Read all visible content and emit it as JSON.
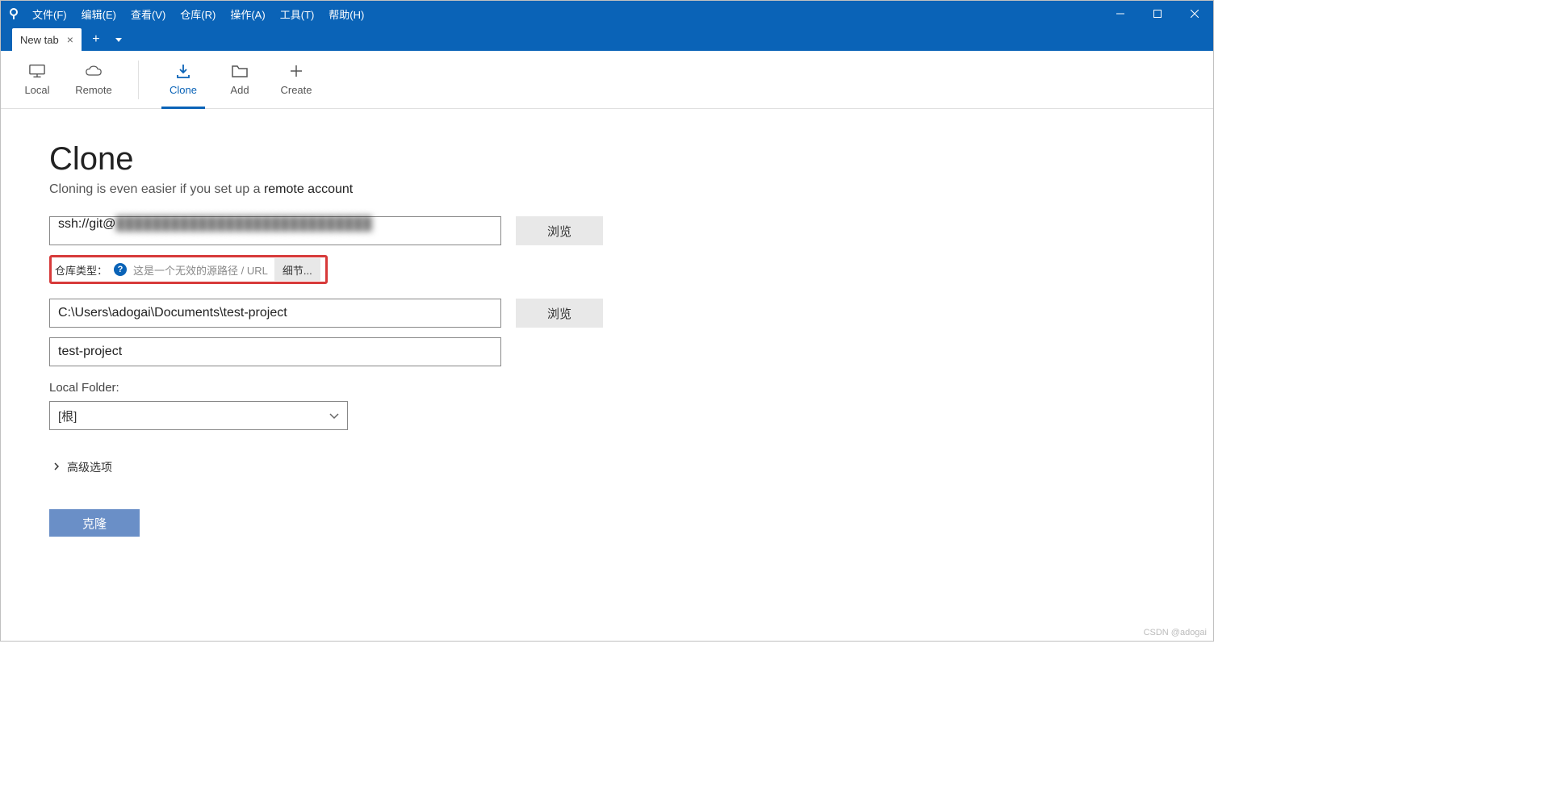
{
  "menubar": {
    "items": [
      "文件(F)",
      "编辑(E)",
      "查看(V)",
      "仓库(R)",
      "操作(A)",
      "工具(T)",
      "帮助(H)"
    ]
  },
  "tabs": {
    "active_label": "New tab"
  },
  "toolbar": {
    "local": "Local",
    "remote": "Remote",
    "clone": "Clone",
    "add": "Add",
    "create": "Create"
  },
  "page": {
    "title": "Clone",
    "subtitle_prefix": "Cloning is even easier if you set up a ",
    "subtitle_link": "remote account"
  },
  "form": {
    "source_url_prefix": "ssh://git@",
    "browse1": "浏览",
    "repo_type_label": "仓库类型：",
    "repo_type_msg": "这是一个无效的源路径 / URL",
    "details_btn": "细节...",
    "dest_path": "C:\\Users\\adogai\\Documents\\test-project",
    "browse2": "浏览",
    "name": "test-project",
    "local_folder_label": "Local Folder:",
    "local_folder_value": "[根]",
    "advanced": "高级选项",
    "clone_btn": "克隆"
  },
  "watermark": "CSDN @adogai"
}
